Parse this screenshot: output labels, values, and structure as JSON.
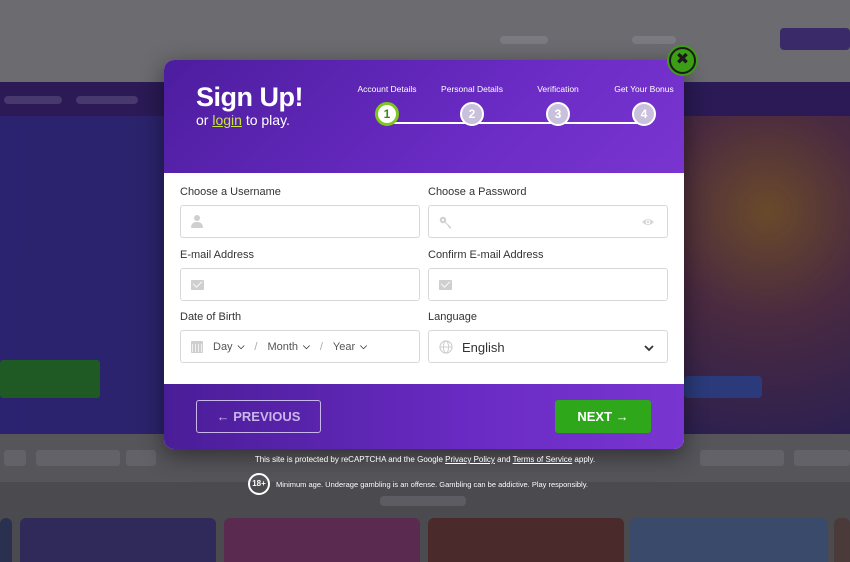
{
  "modal": {
    "title": "Sign Up!",
    "subtitle_prefix": "or",
    "login_link": "login",
    "subtitle_suffix": "to play.",
    "close_glyph": "✖",
    "steps": [
      {
        "label": "Account Details",
        "number": "1",
        "state": "active"
      },
      {
        "label": "Personal Details",
        "number": "2",
        "state": "inactive"
      },
      {
        "label": "Verification",
        "number": "3",
        "state": "inactive"
      },
      {
        "label": "Get Your Bonus",
        "number": "4",
        "state": "inactive"
      }
    ],
    "fields": {
      "username": {
        "label": "Choose a Username",
        "value": "",
        "icon": "user-icon"
      },
      "password": {
        "label": "Choose a Password",
        "value": "",
        "icon": "key-icon",
        "toggle_icon": "eye-icon"
      },
      "email": {
        "label": "E-mail Address",
        "value": "",
        "icon": "mail-icon"
      },
      "confirm_email": {
        "label": "Confirm E-mail Address",
        "value": "",
        "icon": "mail-icon"
      },
      "dob": {
        "label": "Date of Birth",
        "day": "Day",
        "month": "Month",
        "year": "Year",
        "separator": "/",
        "icon": "calendar-icon"
      },
      "language": {
        "label": "Language",
        "value": "English",
        "icon": "globe-icon"
      }
    },
    "buttons": {
      "previous": "PREVIOUS",
      "next": "NEXT"
    }
  },
  "legal": {
    "recaptcha_prefix": "This site is protected by reCAPTCHA and the Google",
    "privacy_link": "Privacy Policy",
    "and": "and",
    "terms_link": "Terms of Service",
    "recaptcha_suffix": "apply.",
    "age_badge": "18+",
    "age_text": "Minimum age. Underage gambling is an offense. Gambling can be addictive. Play responsibly."
  },
  "colors": {
    "brand_purple": "#6a2bc4",
    "accent_green": "#2fa71a",
    "link_lime": "#c8e63a"
  }
}
